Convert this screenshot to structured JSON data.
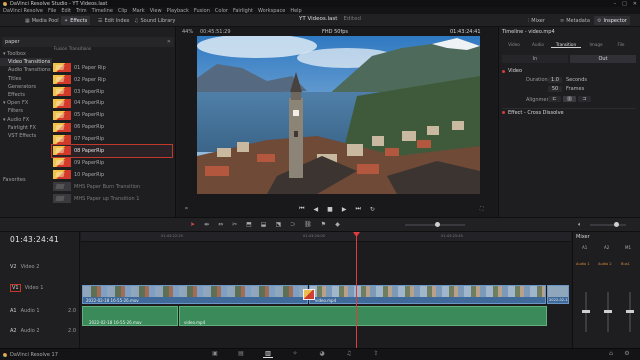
{
  "window": {
    "title": "DaVinci Resolve Studio - YT Videos.last"
  },
  "menu": [
    "DaVinci Resolve",
    "File",
    "Edit",
    "Trim",
    "Timeline",
    "Clip",
    "Mark",
    "View",
    "Playback",
    "Fusion",
    "Color",
    "Fairlight",
    "Workspace",
    "Help"
  ],
  "toolbar": {
    "media_pool": "Media Pool",
    "effects": "Effects",
    "edit_index": "Edit Index",
    "sound_library": "Sound Library",
    "project_title": "YT Videos.last",
    "project_status": "Edited",
    "mixer": "Mixer",
    "metadata": "Metadata",
    "inspector": "Inspector"
  },
  "left": {
    "search_value": "paper",
    "toolbox_header": "Toolbox",
    "fx_header": "Fusion Transitions",
    "tree": [
      "Video Transitions",
      "Audio Transitions",
      "Titles",
      "Generators",
      "Effects"
    ],
    "openfx": "Open FX",
    "openfx_items": [
      "Filters"
    ],
    "audiofx": "Audio FX",
    "audiofx_items": [
      "Fairlight FX",
      "VST Effects"
    ],
    "favorites": "Favorites",
    "fx_items": [
      "01 Paper Rip",
      "02 Paper Rip",
      "03 PaperRip",
      "04 PaperRip",
      "05 PaperRip",
      "06 PaperRip",
      "07 PaperRip",
      "08 PaperRip",
      "09 PaperRip",
      "10 PaperRip",
      "MHS Paper Burn Transition",
      "MHS Paper up Transition 1"
    ],
    "selected_fx_index": 7
  },
  "viewer": {
    "zoom": "44%",
    "source_tc": "00:45:51:29",
    "format": "FHD 50fps",
    "record_tc": "01:43:24:41"
  },
  "inspector": {
    "title": "Timeline - video.mp4",
    "tabs": [
      "Video",
      "Audio",
      "Transition",
      "Image",
      "File"
    ],
    "active_tab": "Transition",
    "in_label": "In",
    "out_label": "Out",
    "video_section": "Video",
    "duration_label": "Duration",
    "duration_value": "1.0",
    "duration_unit": "Seconds",
    "frames_value": "50",
    "frames_unit": "Frames",
    "alignment_label": "Alignment",
    "effect_section": "Effect - Cross Dissolve"
  },
  "timeline": {
    "timecode": "01:43:24:41",
    "ruler": [
      "01:43:22:25",
      "01:43:24:05",
      "01:43:25:45"
    ],
    "tracks": [
      {
        "id": "V2",
        "name": "Video 2"
      },
      {
        "id": "V1",
        "name": "Video 1"
      },
      {
        "id": "A1",
        "name": "Audio 1",
        "channels": "2.0"
      },
      {
        "id": "A2",
        "name": "Audio 2",
        "channels": "2.0"
      }
    ],
    "clip_v1_a": "2022-02-18 16-55-26.mov",
    "clip_v1_b": "video.mp4",
    "clip_v1_c": "2022-02-18...",
    "clip_a1_a": "2022-02-18 16-55-26.mov",
    "clip_a1_b": "video.mp4"
  },
  "mixer": {
    "title": "Mixer",
    "channels": [
      "A1",
      "A2",
      "M1"
    ],
    "audio_labels": [
      "Audio 1",
      "Audio 2",
      "Bus1"
    ]
  },
  "bottom": {
    "app": "DaVinci Resolve 17"
  }
}
